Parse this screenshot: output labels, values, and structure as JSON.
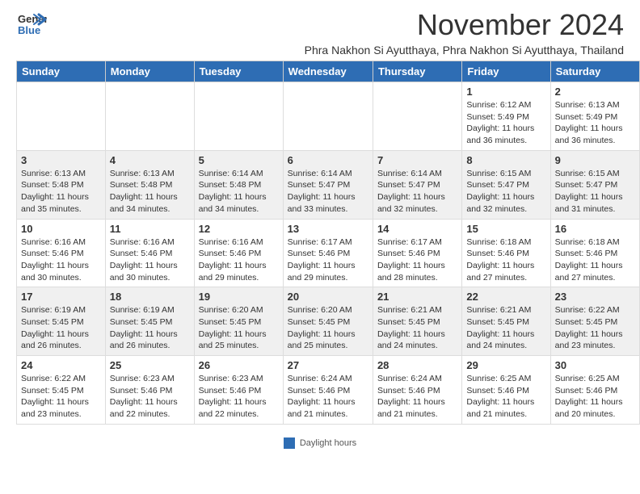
{
  "header": {
    "logo_general": "General",
    "logo_blue": "Blue",
    "month_title": "November 2024",
    "location": "Phra Nakhon Si Ayutthaya, Phra Nakhon Si Ayutthaya, Thailand"
  },
  "calendar": {
    "days_of_week": [
      "Sunday",
      "Monday",
      "Tuesday",
      "Wednesday",
      "Thursday",
      "Friday",
      "Saturday"
    ],
    "weeks": [
      [
        {
          "day": "",
          "detail": ""
        },
        {
          "day": "",
          "detail": ""
        },
        {
          "day": "",
          "detail": ""
        },
        {
          "day": "",
          "detail": ""
        },
        {
          "day": "",
          "detail": ""
        },
        {
          "day": "1",
          "detail": "Sunrise: 6:12 AM\nSunset: 5:49 PM\nDaylight: 11 hours and 36 minutes."
        },
        {
          "day": "2",
          "detail": "Sunrise: 6:13 AM\nSunset: 5:49 PM\nDaylight: 11 hours and 36 minutes."
        }
      ],
      [
        {
          "day": "3",
          "detail": "Sunrise: 6:13 AM\nSunset: 5:48 PM\nDaylight: 11 hours and 35 minutes."
        },
        {
          "day": "4",
          "detail": "Sunrise: 6:13 AM\nSunset: 5:48 PM\nDaylight: 11 hours and 34 minutes."
        },
        {
          "day": "5",
          "detail": "Sunrise: 6:14 AM\nSunset: 5:48 PM\nDaylight: 11 hours and 34 minutes."
        },
        {
          "day": "6",
          "detail": "Sunrise: 6:14 AM\nSunset: 5:47 PM\nDaylight: 11 hours and 33 minutes."
        },
        {
          "day": "7",
          "detail": "Sunrise: 6:14 AM\nSunset: 5:47 PM\nDaylight: 11 hours and 32 minutes."
        },
        {
          "day": "8",
          "detail": "Sunrise: 6:15 AM\nSunset: 5:47 PM\nDaylight: 11 hours and 32 minutes."
        },
        {
          "day": "9",
          "detail": "Sunrise: 6:15 AM\nSunset: 5:47 PM\nDaylight: 11 hours and 31 minutes."
        }
      ],
      [
        {
          "day": "10",
          "detail": "Sunrise: 6:16 AM\nSunset: 5:46 PM\nDaylight: 11 hours and 30 minutes."
        },
        {
          "day": "11",
          "detail": "Sunrise: 6:16 AM\nSunset: 5:46 PM\nDaylight: 11 hours and 30 minutes."
        },
        {
          "day": "12",
          "detail": "Sunrise: 6:16 AM\nSunset: 5:46 PM\nDaylight: 11 hours and 29 minutes."
        },
        {
          "day": "13",
          "detail": "Sunrise: 6:17 AM\nSunset: 5:46 PM\nDaylight: 11 hours and 29 minutes."
        },
        {
          "day": "14",
          "detail": "Sunrise: 6:17 AM\nSunset: 5:46 PM\nDaylight: 11 hours and 28 minutes."
        },
        {
          "day": "15",
          "detail": "Sunrise: 6:18 AM\nSunset: 5:46 PM\nDaylight: 11 hours and 27 minutes."
        },
        {
          "day": "16",
          "detail": "Sunrise: 6:18 AM\nSunset: 5:46 PM\nDaylight: 11 hours and 27 minutes."
        }
      ],
      [
        {
          "day": "17",
          "detail": "Sunrise: 6:19 AM\nSunset: 5:45 PM\nDaylight: 11 hours and 26 minutes."
        },
        {
          "day": "18",
          "detail": "Sunrise: 6:19 AM\nSunset: 5:45 PM\nDaylight: 11 hours and 26 minutes."
        },
        {
          "day": "19",
          "detail": "Sunrise: 6:20 AM\nSunset: 5:45 PM\nDaylight: 11 hours and 25 minutes."
        },
        {
          "day": "20",
          "detail": "Sunrise: 6:20 AM\nSunset: 5:45 PM\nDaylight: 11 hours and 25 minutes."
        },
        {
          "day": "21",
          "detail": "Sunrise: 6:21 AM\nSunset: 5:45 PM\nDaylight: 11 hours and 24 minutes."
        },
        {
          "day": "22",
          "detail": "Sunrise: 6:21 AM\nSunset: 5:45 PM\nDaylight: 11 hours and 24 minutes."
        },
        {
          "day": "23",
          "detail": "Sunrise: 6:22 AM\nSunset: 5:45 PM\nDaylight: 11 hours and 23 minutes."
        }
      ],
      [
        {
          "day": "24",
          "detail": "Sunrise: 6:22 AM\nSunset: 5:45 PM\nDaylight: 11 hours and 23 minutes."
        },
        {
          "day": "25",
          "detail": "Sunrise: 6:23 AM\nSunset: 5:46 PM\nDaylight: 11 hours and 22 minutes."
        },
        {
          "day": "26",
          "detail": "Sunrise: 6:23 AM\nSunset: 5:46 PM\nDaylight: 11 hours and 22 minutes."
        },
        {
          "day": "27",
          "detail": "Sunrise: 6:24 AM\nSunset: 5:46 PM\nDaylight: 11 hours and 21 minutes."
        },
        {
          "day": "28",
          "detail": "Sunrise: 6:24 AM\nSunset: 5:46 PM\nDaylight: 11 hours and 21 minutes."
        },
        {
          "day": "29",
          "detail": "Sunrise: 6:25 AM\nSunset: 5:46 PM\nDaylight: 11 hours and 21 minutes."
        },
        {
          "day": "30",
          "detail": "Sunrise: 6:25 AM\nSunset: 5:46 PM\nDaylight: 11 hours and 20 minutes."
        }
      ]
    ]
  },
  "footer": {
    "swatch_label": "Daylight hours"
  }
}
